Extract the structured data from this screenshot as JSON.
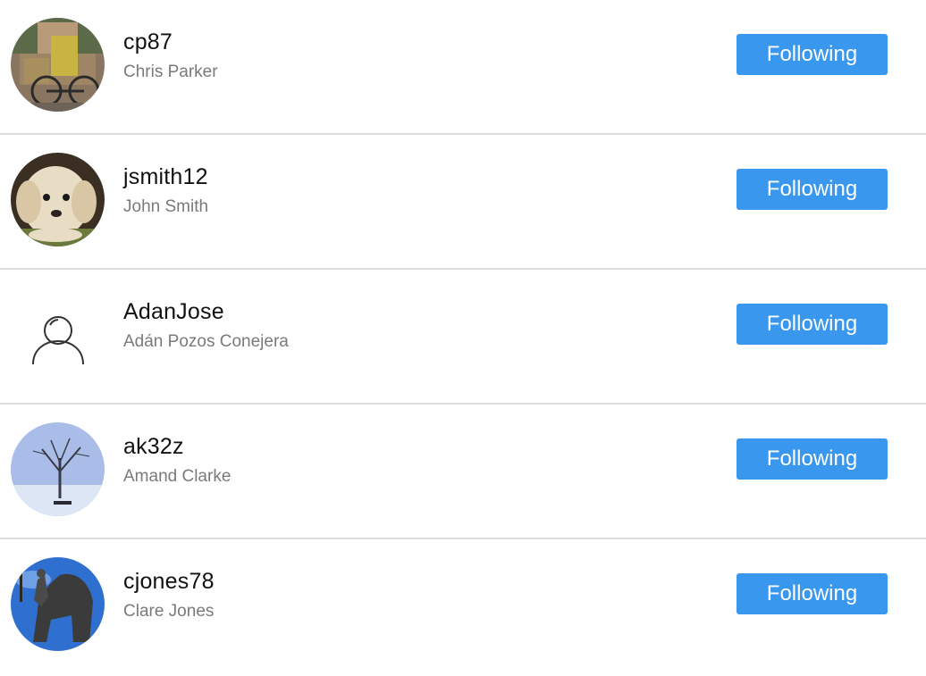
{
  "users": [
    {
      "username": "cp87",
      "fullname": "Chris Parker",
      "button_label": "Following",
      "avatar": "bicycle-photo"
    },
    {
      "username": "jsmith12",
      "fullname": "John Smith",
      "button_label": "Following",
      "avatar": "puppy-photo"
    },
    {
      "username": "AdanJose",
      "fullname": "Adán Pozos Conejera",
      "button_label": "Following",
      "avatar": "default-user-icon"
    },
    {
      "username": "ak32z",
      "fullname": "Amand Clarke",
      "button_label": "Following",
      "avatar": "winter-tree-photo"
    },
    {
      "username": "cjones78",
      "fullname": "Clare Jones",
      "button_label": "Following",
      "avatar": "statue-photo"
    }
  ],
  "colors": {
    "button_bg": "#3a97ee",
    "button_text": "#ffffff",
    "username": "#111111",
    "fullname": "#7a7a7a",
    "divider": "#dcdcdc"
  }
}
